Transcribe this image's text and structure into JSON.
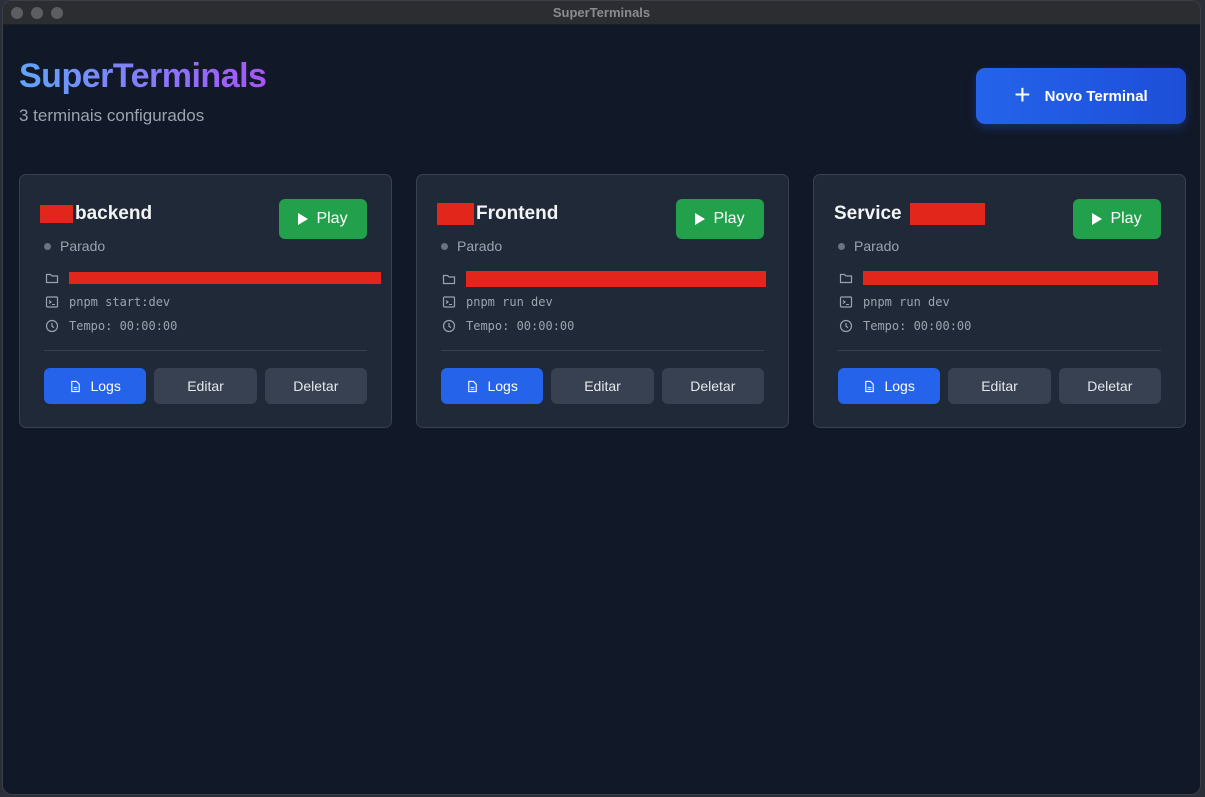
{
  "window": {
    "title": "SuperTerminals"
  },
  "header": {
    "title": "SuperTerminals",
    "subtitle": "3 terminais configurados",
    "new_button": "Novo Terminal"
  },
  "colors": {
    "accent": "#2563eb",
    "play": "#22a04b",
    "card": "#1f2937",
    "background": "#111827"
  },
  "cards": [
    {
      "name": "backend",
      "status": "Parado",
      "command": "pnpm start:dev",
      "time": "Tempo: 00:00:00",
      "play": "Play",
      "logs": "Logs",
      "edit": "Editar",
      "delete": "Deletar"
    },
    {
      "name": "Frontend",
      "status": "Parado",
      "command": "pnpm run dev",
      "time": "Tempo: 00:00:00",
      "play": "Play",
      "logs": "Logs",
      "edit": "Editar",
      "delete": "Deletar"
    },
    {
      "name": "Service",
      "status": "Parado",
      "command": "pnpm run dev",
      "time": "Tempo: 00:00:00",
      "play": "Play",
      "logs": "Logs",
      "edit": "Editar",
      "delete": "Deletar"
    }
  ]
}
